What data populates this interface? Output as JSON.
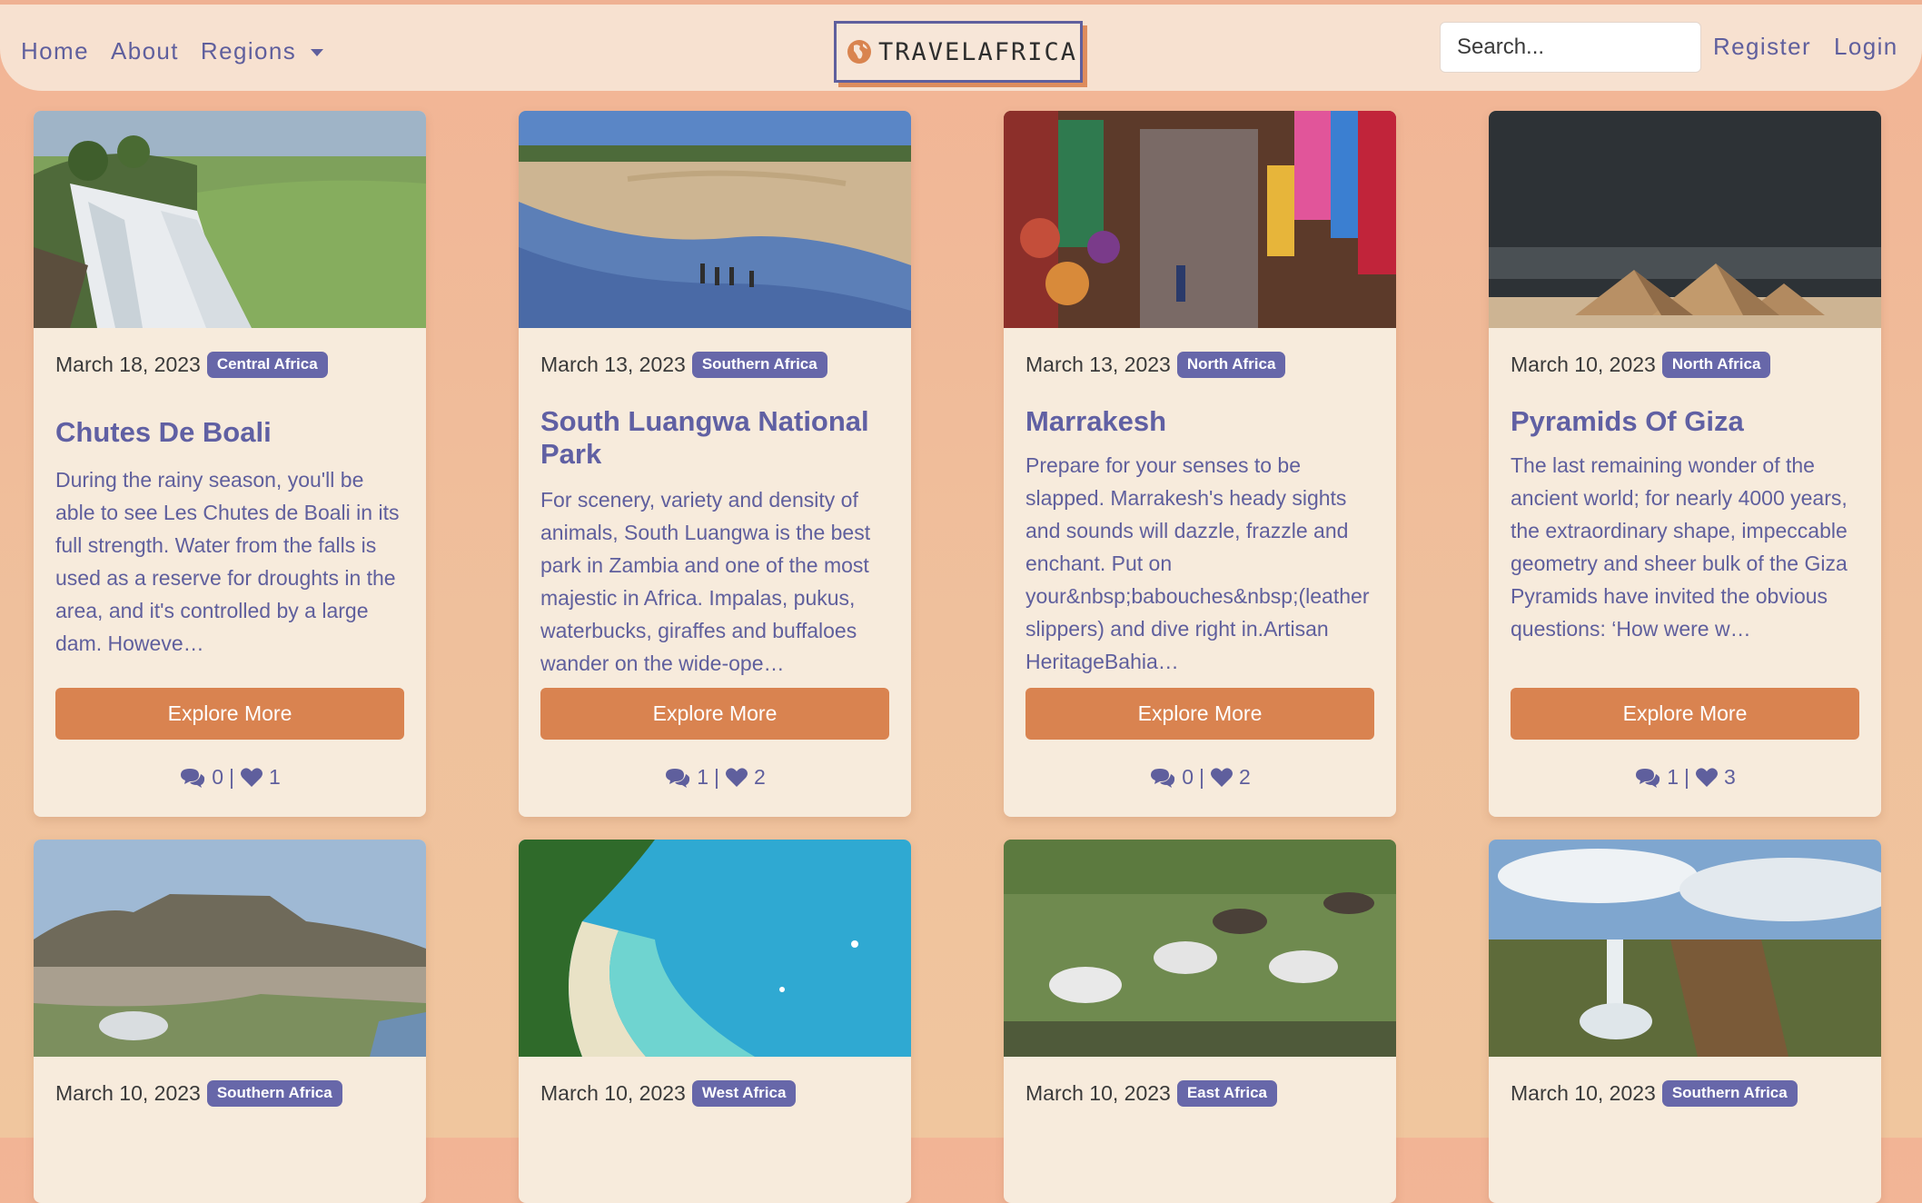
{
  "nav": {
    "home": "Home",
    "about": "About",
    "regions": "Regions",
    "brand": "TRAVELAFRICA",
    "search_placeholder": "Search...",
    "register": "Register",
    "login": "Login"
  },
  "cards": [
    {
      "date": "March 18, 2023",
      "region": "Central Africa",
      "title": "Chutes De Boali",
      "description": "During the rainy season, you'll be able to see Les Chutes de Boali in its full strength. Water from the falls is used as a reserve for droughts in the area, and it's controlled by a large dam. Howeve…",
      "button": "Explore More",
      "comments": "0",
      "separator": "|",
      "likes": "1",
      "image": "waterfall-with-green-hills"
    },
    {
      "date": "March 13, 2023",
      "region": "Southern Africa",
      "title": "South Luangwa National Park",
      "description": "For scenery, variety and density of animals, South Luangwa is the best park in Zambia and one of the most majestic in Africa. Impalas, pukus, waterbucks, giraffes and buffaloes wander on the wide-ope…",
      "button": "Explore More",
      "comments": "1",
      "separator": "|",
      "likes": "2",
      "image": "people-walking-river-sandbank"
    },
    {
      "date": "March 13, 2023",
      "region": "North Africa",
      "title": "Marrakesh",
      "description": "Prepare for your senses to be slapped. Marrakesh's heady sights and sounds will dazzle, frazzle and enchant. Put on your&nbsp;babouches&nbsp;(leather slippers) and dive right in.Artisan HeritageBahia…",
      "button": "Explore More",
      "comments": "0",
      "separator": "|",
      "likes": "2",
      "image": "colorful-souk-market"
    },
    {
      "date": "March 10, 2023",
      "region": "North Africa",
      "title": "Pyramids Of Giza",
      "description": "The last remaining wonder of the ancient world; for nearly 4000 years, the extraordinary shape, impeccable geometry and sheer bulk of the Giza Pyramids have invited the obvious questions: ‘How were w…",
      "button": "Explore More",
      "comments": "1",
      "separator": "|",
      "likes": "3",
      "image": "pyramids-under-dark-sky"
    }
  ],
  "cards_row2": [
    {
      "date": "March 10, 2023",
      "region": "Southern Africa",
      "image": "table-mountain-city"
    },
    {
      "date": "March 10, 2023",
      "region": "West Africa",
      "image": "turquoise-bay-beach"
    },
    {
      "date": "March 10, 2023",
      "region": "East Africa",
      "image": "zebras-grazing"
    },
    {
      "date": "March 10, 2023",
      "region": "Southern Africa",
      "image": "waterfall-gorge-clouds"
    }
  ],
  "colors": {
    "accent": "#6767a9",
    "button": "#d98350",
    "card_bg": "#f7ebdc",
    "nav_bg": "#f7e1d0"
  }
}
